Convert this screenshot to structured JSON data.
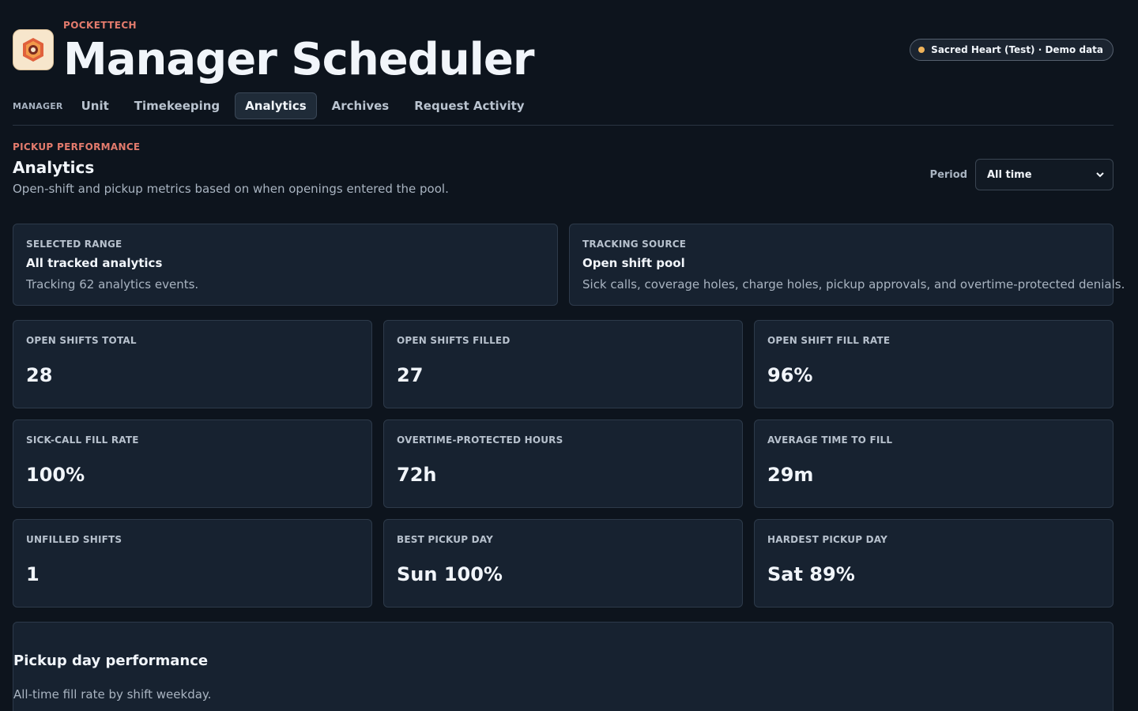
{
  "header": {
    "brand": "POCKETTECH",
    "title": "Manager Scheduler",
    "badge": "Sacred Heart (Test) · Demo data"
  },
  "nav": {
    "role": "MANAGER",
    "tabs": [
      {
        "label": "Unit",
        "active": false
      },
      {
        "label": "Timekeeping",
        "active": false
      },
      {
        "label": "Analytics",
        "active": true
      },
      {
        "label": "Archives",
        "active": false
      },
      {
        "label": "Request Activity",
        "active": false
      }
    ]
  },
  "section": {
    "eyebrow": "PICKUP PERFORMANCE",
    "title": "Analytics",
    "description": "Open-shift and pickup metrics based on when openings entered the pool.",
    "period_label": "Period",
    "period_value": "All time"
  },
  "info_cards": [
    {
      "label": "SELECTED RANGE",
      "title": "All tracked analytics",
      "description": "Tracking 62 analytics events."
    },
    {
      "label": "TRACKING SOURCE",
      "title": "Open shift pool",
      "description": "Sick calls, coverage holes, charge holes, pickup approvals, and overtime-protected denials."
    }
  ],
  "metrics": [
    {
      "label": "OPEN SHIFTS TOTAL",
      "value": "28"
    },
    {
      "label": "OPEN SHIFTS FILLED",
      "value": "27"
    },
    {
      "label": "OPEN SHIFT FILL RATE",
      "value": "96%"
    },
    {
      "label": "SICK-CALL FILL RATE",
      "value": "100%"
    },
    {
      "label": "OVERTIME-PROTECTED HOURS",
      "value": "72h"
    },
    {
      "label": "AVERAGE TIME TO FILL",
      "value": "29m"
    },
    {
      "label": "UNFILLED SHIFTS",
      "value": "1"
    },
    {
      "label": "BEST PICKUP DAY",
      "value": "Sun 100%"
    },
    {
      "label": "HARDEST PICKUP DAY",
      "value": "Sat 89%"
    }
  ],
  "day_performance": {
    "title": "Pickup day performance",
    "description": "All-time fill rate by shift weekday."
  },
  "colors": {
    "background": "#0d141d",
    "card": "#172230",
    "accent": "#e37b6d",
    "badge_dot": "#f0b35a"
  }
}
